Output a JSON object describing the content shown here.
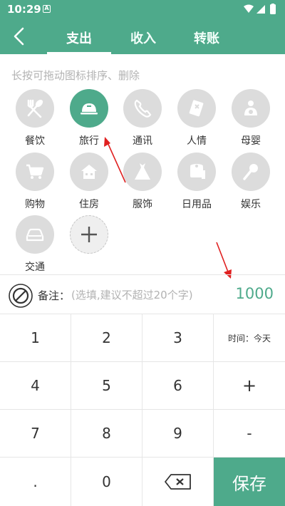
{
  "status_bar": {
    "time": "10:29",
    "notification": "A"
  },
  "tabs": [
    {
      "label": "支出",
      "selected": true
    },
    {
      "label": "收入",
      "selected": false
    },
    {
      "label": "转账",
      "selected": false
    }
  ],
  "hint": "长按可拖动图标排序、删除",
  "categories": [
    {
      "label": "餐饮",
      "icon": "fork-spoon-icon"
    },
    {
      "label": "旅行",
      "icon": "travel-icon",
      "selected": true
    },
    {
      "label": "通讯",
      "icon": "phone-icon"
    },
    {
      "label": "人情",
      "icon": "gift-card-icon"
    },
    {
      "label": "母婴",
      "icon": "baby-icon"
    },
    {
      "label": "购物",
      "icon": "cart-icon"
    },
    {
      "label": "住房",
      "icon": "house-icon"
    },
    {
      "label": "服饰",
      "icon": "dress-icon"
    },
    {
      "label": "日用品",
      "icon": "tissue-icon"
    },
    {
      "label": "娱乐",
      "icon": "microphone-icon"
    },
    {
      "label": "交通",
      "icon": "car-icon"
    }
  ],
  "add_category_icon": "plus-icon",
  "memo": {
    "label": "备注：",
    "placeholder": "(选填,建议不超过20个字)"
  },
  "amount": "1000",
  "keypad": {
    "keys": [
      "1",
      "2",
      "3",
      "4",
      "5",
      "6",
      "7",
      "8",
      "9",
      ".",
      "0"
    ],
    "time_label": "时间：今天",
    "plus": "+",
    "minus": "-",
    "save": "保存"
  },
  "colors": {
    "accent": "#4eaa8b",
    "annotation_arrow": "#e02020"
  }
}
